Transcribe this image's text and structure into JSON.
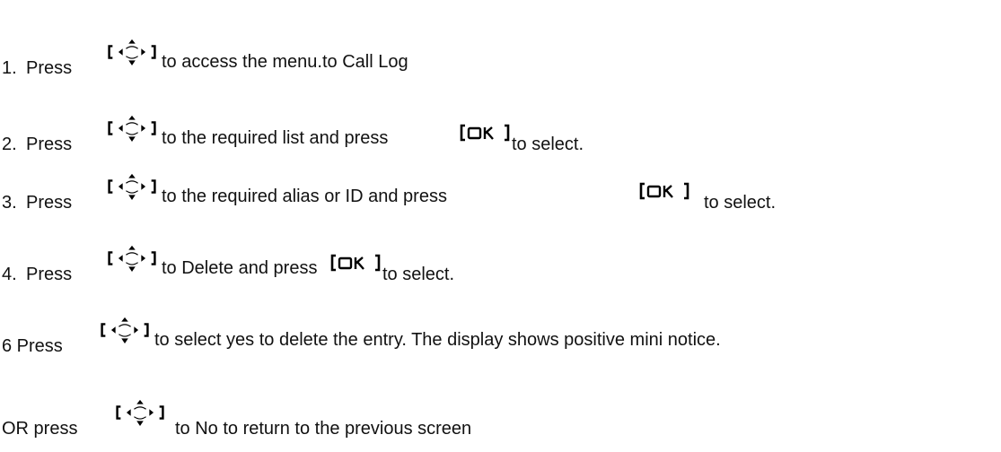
{
  "steps": [
    {
      "number": "1.",
      "label": "Press",
      "after_nav": "to access the menu.to Call Log"
    },
    {
      "number": "2.",
      "label": "Press",
      "after_nav": "to the required list and press",
      "after_ok": "to select."
    },
    {
      "number": "3.",
      "label": "Press",
      "after_nav": "to the required alias or ID and press",
      "after_ok": "to select."
    },
    {
      "number": "4.",
      "label": "Press",
      "after_nav": "to Delete and press",
      "after_ok": "to select."
    },
    {
      "prefix": "6 Press",
      "after_nav": "to select yes to delete the entry. The display shows positive mini notice."
    },
    {
      "prefix": "OR press",
      "after_nav": "to No to return to the previous screen"
    }
  ],
  "icons": {
    "nav_key": "navigation-key-icon",
    "ok_key": "ok-key-icon"
  },
  "ok_key_label": "OK"
}
